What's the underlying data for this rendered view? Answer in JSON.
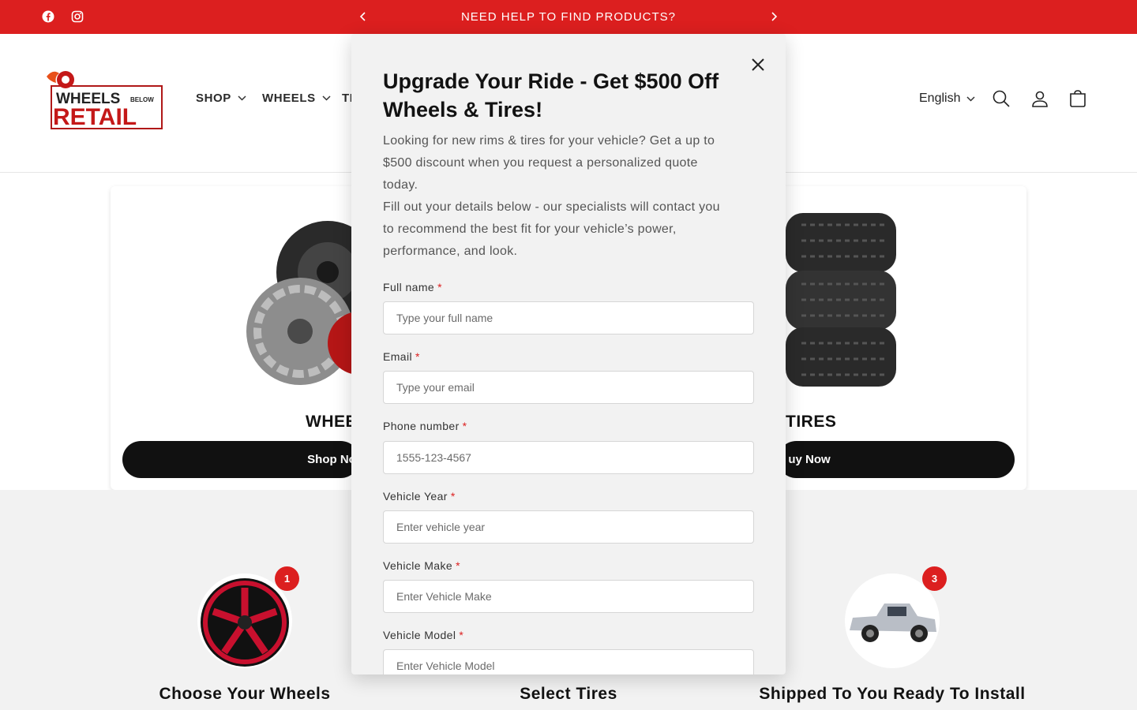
{
  "announcement": {
    "text": "NEED HELP TO FIND PRODUCTS?"
  },
  "social": [
    "facebook-icon",
    "instagram-icon"
  ],
  "header": {
    "logo_text_top": "WHEELS",
    "logo_text_small": "BELOW",
    "logo_text_bottom": "RETAIL",
    "nav": [
      {
        "label": "SHOP"
      },
      {
        "label": "WHEELS"
      },
      {
        "label": "TI"
      }
    ],
    "language": "English"
  },
  "cards": [
    {
      "title": "WHEE",
      "button": "Shop No"
    },
    {
      "title": "TIRES",
      "button": "uy Now"
    }
  ],
  "steps": [
    {
      "badge": "1",
      "title": "Choose Your Wheels"
    },
    {
      "badge": "",
      "title": "Select Tires"
    },
    {
      "badge": "3",
      "title": "Shipped To You Ready To Install"
    }
  ],
  "popup": {
    "title": "Upgrade Your Ride - Get $500 Off Wheels & Tires!",
    "desc1": "Looking for new rims & tires for your vehicle? Get a up to $500 discount when you request a personalized quote today.",
    "desc2": "Fill out your details below - our specialists will contact you to recommend the best fit for your vehicle’s power, performance, and look.",
    "required_mark": "*",
    "fields": [
      {
        "label": "Full name",
        "placeholder": "Type your full name"
      },
      {
        "label": "Email",
        "placeholder": "Type your email"
      },
      {
        "label": "Phone number",
        "placeholder": "1555-123-4567"
      },
      {
        "label": "Vehicle Year",
        "placeholder": "Enter vehicle year"
      },
      {
        "label": "Vehicle Make",
        "placeholder": "Enter Vehicle Make"
      },
      {
        "label": "Vehicle Model",
        "placeholder": "Enter Vehicle Model"
      }
    ]
  },
  "colors": {
    "brand_red": "#dc1f1f",
    "button_black": "#111111",
    "popup_bg": "#f2f2f2"
  }
}
